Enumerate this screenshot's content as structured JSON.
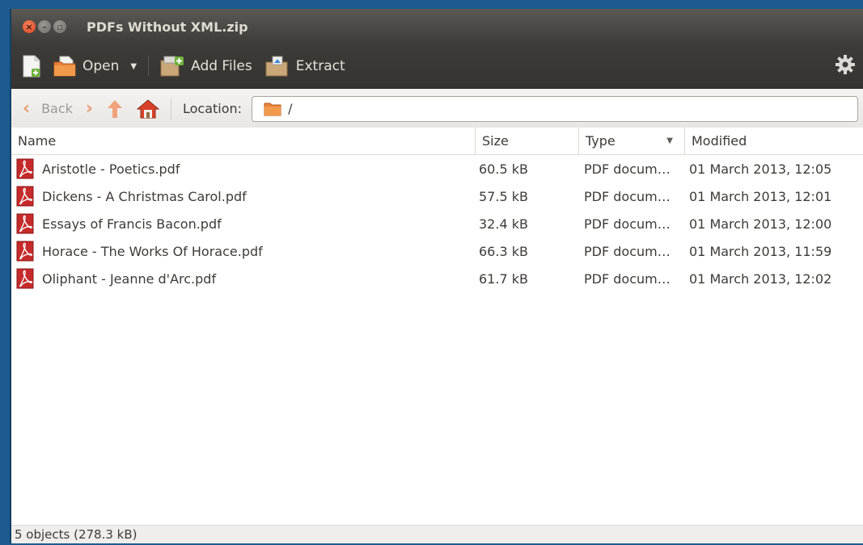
{
  "window": {
    "title": "PDFs Without XML.zip"
  },
  "toolbar": {
    "open_label": "Open",
    "add_files_label": "Add Files",
    "extract_label": "Extract"
  },
  "location": {
    "back_label": "Back",
    "label": "Location:",
    "path": "/"
  },
  "table": {
    "columns": [
      "Name",
      "Size",
      "Type",
      "Modified"
    ],
    "rows": [
      {
        "name": "Aristotle - Poetics.pdf",
        "size": "60.5 kB",
        "type": "PDF docum…",
        "modified": "01 March 2013, 12:05"
      },
      {
        "name": "Dickens - A Christmas Carol.pdf",
        "size": "57.5 kB",
        "type": "PDF docum…",
        "modified": "01 March 2013, 12:01"
      },
      {
        "name": "Essays of Francis Bacon.pdf",
        "size": "32.4 kB",
        "type": "PDF docum…",
        "modified": "01 March 2013, 12:00"
      },
      {
        "name": "Horace - The Works Of Horace.pdf",
        "size": "66.3 kB",
        "type": "PDF docum…",
        "modified": "01 March 2013, 11:59"
      },
      {
        "name": "Oliphant - Jeanne d'Arc.pdf",
        "size": "61.7 kB",
        "type": "PDF docum…",
        "modified": "01 March 2013, 12:02"
      }
    ]
  },
  "status": {
    "text": "5 objects (278.3 kB)"
  },
  "colors": {
    "accent": "#e0461f",
    "titlebar": "#3c3b37",
    "desktop": "#1d5a8f"
  }
}
